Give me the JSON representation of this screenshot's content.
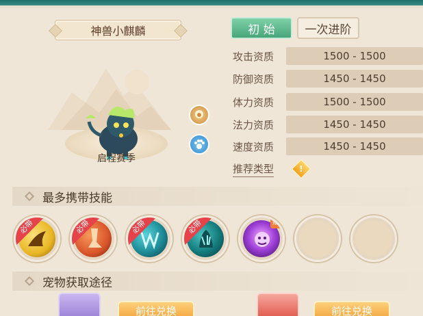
{
  "pet": {
    "name": "神兽小麒麟",
    "season": "启程赛季"
  },
  "tabs": [
    {
      "label": "初 始",
      "active": true
    },
    {
      "label": "一次进阶",
      "active": false
    }
  ],
  "stats": [
    {
      "label": "攻击资质",
      "value": "1500 - 1500"
    },
    {
      "label": "防御资质",
      "value": "1450 - 1450"
    },
    {
      "label": "体力资质",
      "value": "1500 - 1500"
    },
    {
      "label": "法力资质",
      "value": "1450 - 1450"
    },
    {
      "label": "速度资质",
      "value": "1450 - 1450"
    }
  ],
  "recommend_label": "推荐类型",
  "sections": {
    "skills": "最多携带技能",
    "acquire": "宠物获取途径"
  },
  "skills": [
    {
      "tag": "必带",
      "icon": "wing-slash-icon",
      "color": "#e8b624"
    },
    {
      "tag": "必带",
      "icon": "fire-leg-icon",
      "color": "#d9542a"
    },
    {
      "tag": "必带",
      "icon": "ice-fang-icon",
      "color": "#1d8c96"
    },
    {
      "tag": "必带",
      "icon": "water-claw-icon",
      "color": "#147a7c"
    },
    {
      "tag": "赋",
      "icon": "purple-beast-icon",
      "color": "#7a34b8"
    },
    {
      "icon": "empty-slot-icon"
    },
    {
      "icon": "empty-slot-icon"
    }
  ],
  "acquire_buttons": [
    "前往兑换",
    "前往兑换"
  ],
  "colors": {
    "accent_green": "#47a57a",
    "tag_red": "#e6424a",
    "button_orange": "#f2a23a"
  }
}
